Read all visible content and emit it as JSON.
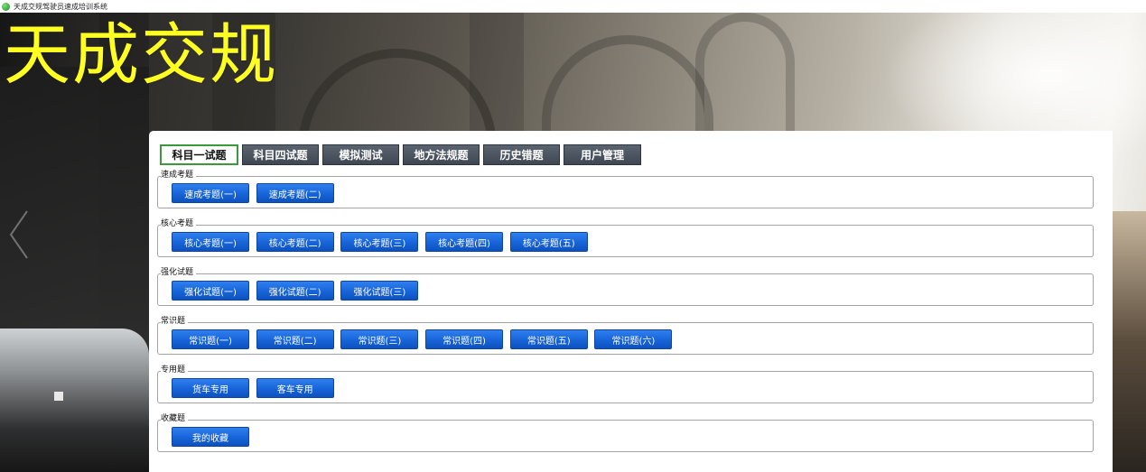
{
  "window": {
    "title": "天成交规驾驶员速成培训系统"
  },
  "brand": {
    "title": "天成交规"
  },
  "tabs": [
    {
      "label": "科目一试题",
      "active": true
    },
    {
      "label": "科目四试题",
      "active": false
    },
    {
      "label": "模拟测试",
      "active": false
    },
    {
      "label": "地方法规题",
      "active": false
    },
    {
      "label": "历史错题",
      "active": false
    },
    {
      "label": "用户管理",
      "active": false
    }
  ],
  "groups": [
    {
      "legend": "速成考题",
      "buttons": [
        "速成考题(一)",
        "速成考题(二)"
      ]
    },
    {
      "legend": "核心考题",
      "buttons": [
        "核心考题(一)",
        "核心考题(二)",
        "核心考题(三)",
        "核心考题(四)",
        "核心考题(五)"
      ]
    },
    {
      "legend": "强化试题",
      "buttons": [
        "强化试题(一)",
        "强化试题(二)",
        "强化试题(三)"
      ]
    },
    {
      "legend": "常识题",
      "buttons": [
        "常识题(一)",
        "常识题(二)",
        "常识题(三)",
        "常识题(四)",
        "常识题(五)",
        "常识题(六)"
      ]
    },
    {
      "legend": "专用题",
      "buttons": [
        "货车专用",
        "客车专用"
      ]
    },
    {
      "legend": "收藏题",
      "buttons": [
        "我的收藏"
      ]
    }
  ],
  "colors": {
    "title_yellow": "#ffff22",
    "button_blue": "#1764d8",
    "active_tab_border": "#3a9a3a",
    "tab_dark": "#48515b"
  }
}
